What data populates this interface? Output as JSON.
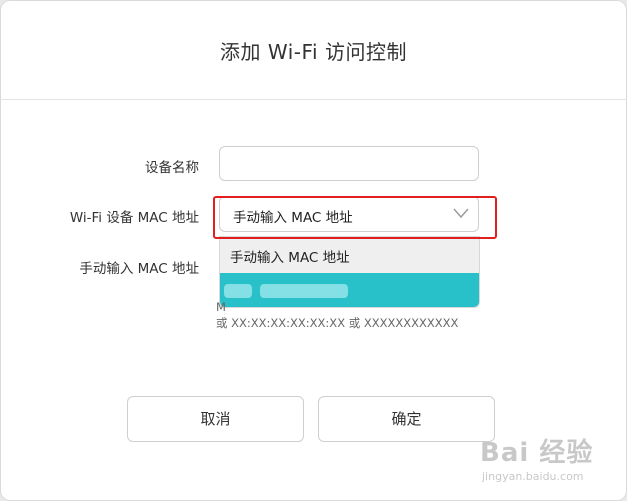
{
  "dialog": {
    "title": "添加 Wi-Fi 访问控制",
    "device_name_label": "设备名称",
    "device_name_value": "",
    "mac_label": "Wi-Fi 设备 MAC 地址",
    "mac_select_value": "手动输入 MAC 地址",
    "manual_mac_label": "手动输入 MAC 地址",
    "dropdown_options": [
      "手动输入 MAC 地址",
      ""
    ],
    "hint_line1": "M",
    "hint_line2": "或 XX:XX:XX:XX:XX:XX 或 XXXXXXXXXXXX",
    "cancel_label": "取消",
    "ok_label": "确定"
  },
  "watermark": {
    "brand": "Bai 经验",
    "url": "jingyan.baidu.com"
  },
  "colors": {
    "highlight_border": "#e21e1e",
    "selected_option": "#28c0c9",
    "hover_option": "#efefef"
  },
  "icons": {
    "select_chevron": "chevron-down-icon",
    "watermark_logo": "paw-icon"
  }
}
